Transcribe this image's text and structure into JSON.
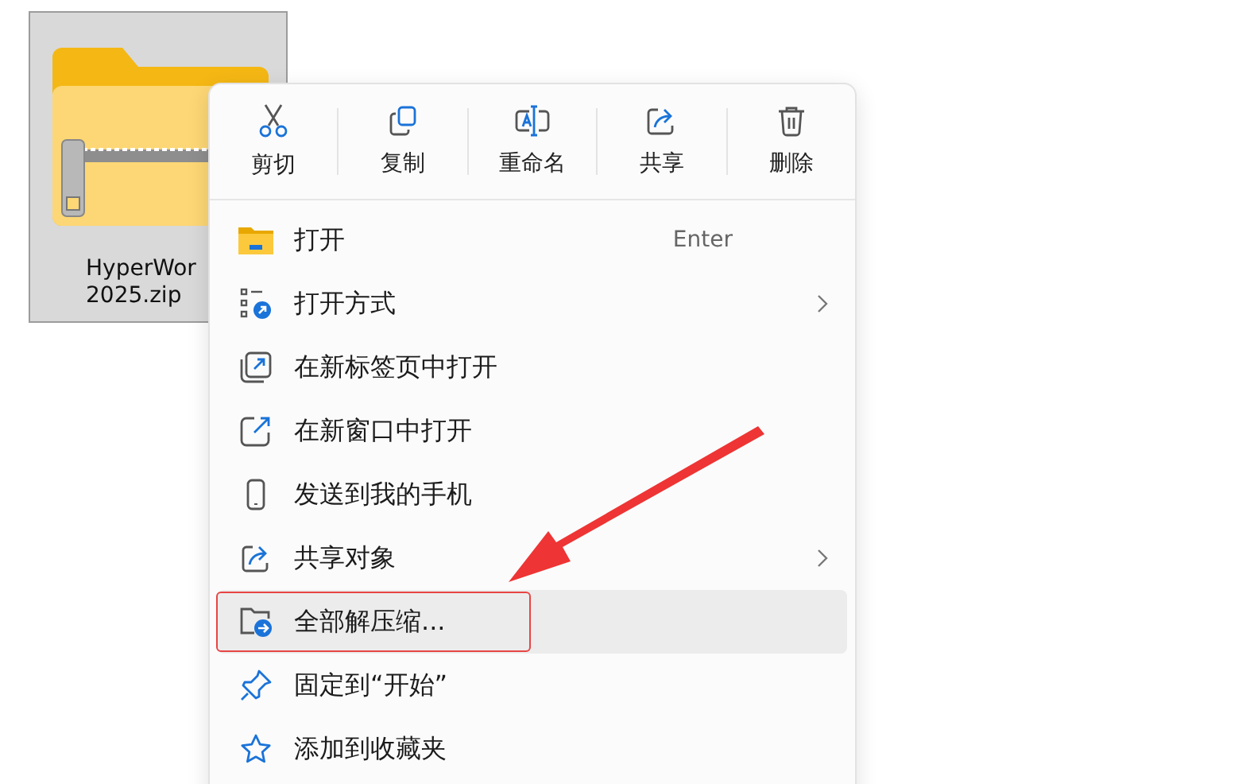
{
  "file": {
    "name_lines": [
      "HyperWor",
      "2025.zip"
    ],
    "selected": true
  },
  "toolbar": [
    {
      "label": "剪切"
    },
    {
      "label": "复制"
    },
    {
      "label": "重命名"
    },
    {
      "label": "共享"
    },
    {
      "label": "删除"
    }
  ],
  "items": [
    {
      "label": "打开",
      "shortcut": "Enter",
      "submenu": false,
      "highlighted": false
    },
    {
      "label": "打开方式",
      "submenu": true,
      "highlighted": false
    },
    {
      "label": "在新标签页中打开",
      "submenu": false,
      "highlighted": false
    },
    {
      "label": "在新窗口中打开",
      "submenu": false,
      "highlighted": false
    },
    {
      "label": "发送到我的手机",
      "submenu": false,
      "highlighted": false
    },
    {
      "label": "共享对象",
      "submenu": true,
      "highlighted": false
    },
    {
      "label": "全部解压缩...",
      "submenu": false,
      "highlighted": true
    },
    {
      "label": "固定到“开始”",
      "submenu": false,
      "highlighted": false
    },
    {
      "label": "添加到收藏夹",
      "submenu": false,
      "highlighted": false
    }
  ]
}
